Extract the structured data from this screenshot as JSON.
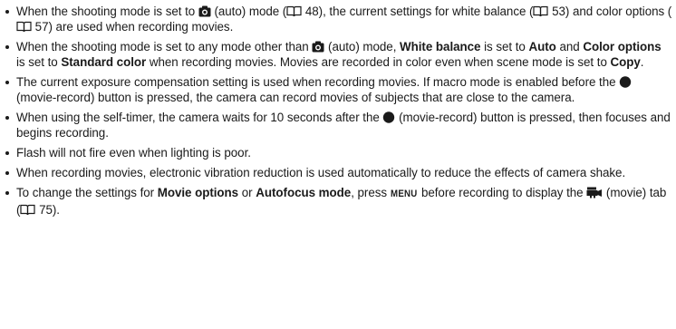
{
  "icons": {
    "camera": "auto-mode-camera-icon",
    "book": "page-reference-book-icon",
    "record": "movie-record-button-icon",
    "movie": "movie-tab-film-camera-icon",
    "menu": "MENU"
  },
  "bullets": [
    {
      "t1": "When the shooting mode is set to ",
      "t2": " (auto) mode (",
      "p1": " 48), the current settings for white balance (",
      "p2": " 53) and color options (",
      "p3": " 57) are used when recording movies."
    },
    {
      "t1": "When the shooting mode is set to any mode other than ",
      "t2": " (auto) mode, ",
      "b1": "White balance",
      "t3": " is set to ",
      "b2": "Auto",
      "t4": " and ",
      "b3": "Color options",
      "t5": " is set to ",
      "b4": "Standard color",
      "t6": " when recording movies. Movies are recorded in color even when scene mode is set to ",
      "b5": "Copy",
      "t7": "."
    },
    {
      "t1": "The current exposure compensation setting is used when recording movies. If macro mode is enabled before the ",
      "t2": " (movie-record) button is pressed, the camera can record movies of subjects that are close to the camera."
    },
    {
      "t1": "When using the self-timer, the camera waits for 10 seconds after the ",
      "t2": " (movie-record) button is pressed, then focuses and begins recording."
    },
    {
      "t1": "Flash will not fire even when lighting is poor."
    },
    {
      "t1": "When recording movies, electronic vibration reduction is used automatically to reduce the effects of camera shake."
    },
    {
      "t1": "To change the settings for ",
      "b1": "Movie options",
      "t2": " or ",
      "b2": "Autofocus mode",
      "t3": ", press ",
      "menu": "MENU",
      "t4": " before recording to display the ",
      "t5": " (movie) tab (",
      "p1": " 75)."
    }
  ]
}
